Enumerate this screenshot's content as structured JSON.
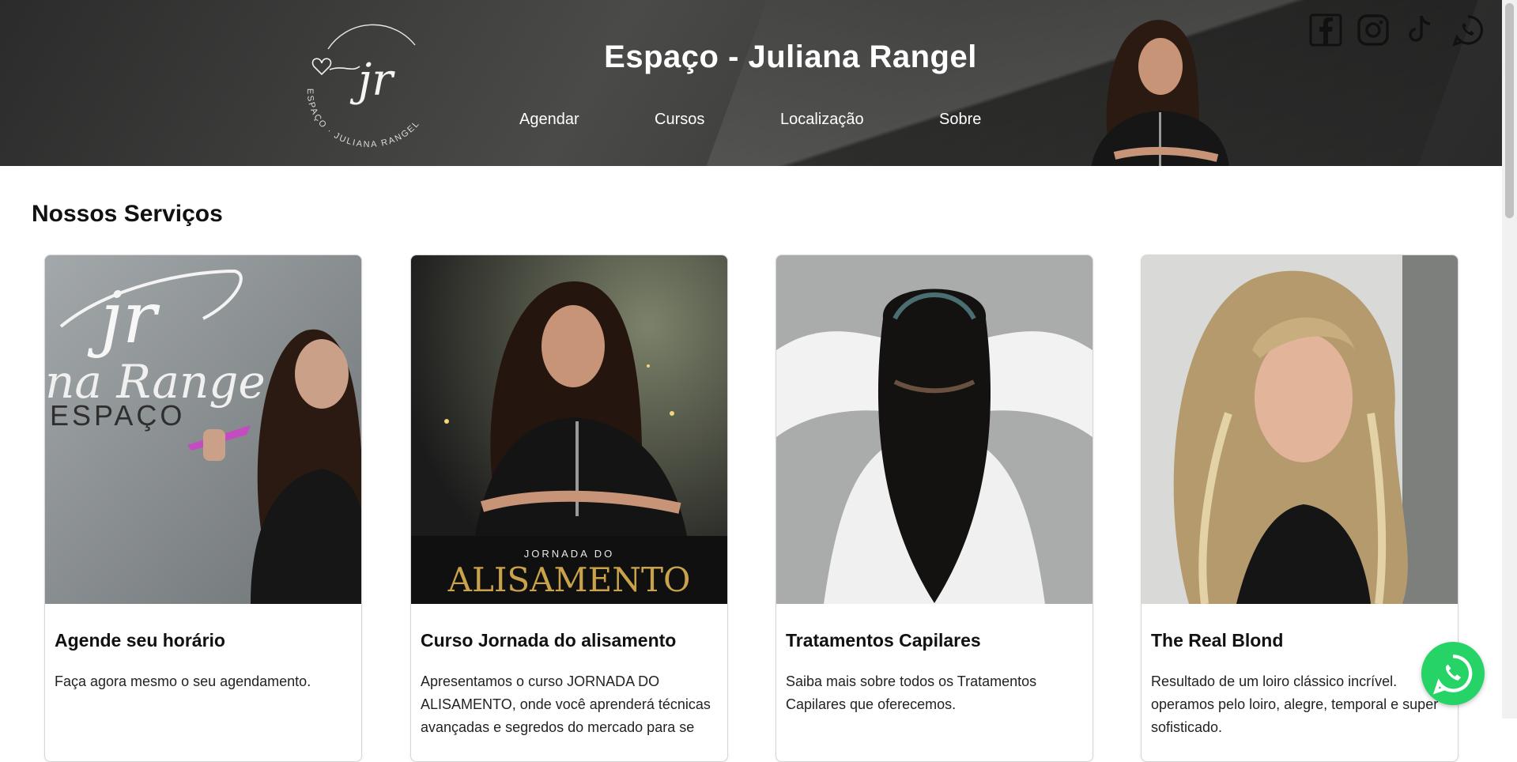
{
  "header": {
    "title": "Espaço - Juliana Rangel",
    "logo_text": "jr",
    "logo_ring_text": "ESPAÇO · JULIANA RANGEL",
    "nav": [
      {
        "label": "Agendar"
      },
      {
        "label": "Cursos"
      },
      {
        "label": "Localização"
      },
      {
        "label": "Sobre"
      }
    ],
    "social_icons": [
      "facebook-icon",
      "instagram-icon",
      "tiktok-icon",
      "whatsapp-icon"
    ]
  },
  "services": {
    "title": "Nossos Serviços",
    "cards": [
      {
        "title": "Agende seu horário",
        "text": "Faça agora mesmo o seu agendamento.",
        "image_text": [
          "jr",
          "na Range",
          "ESPAÇO"
        ]
      },
      {
        "title": "Curso Jornada do alisamento",
        "text": "Apresentamos o curso JORNADA DO ALISAMENTO, onde você aprenderá técnicas avançadas e segredos do mercado para se",
        "image_text": [
          "JORNADA DO",
          "ALISAMENTO"
        ]
      },
      {
        "title": "Tratamentos Capilares",
        "text": "Saiba mais sobre todos os Tratamentos Capilares que oferecemos."
      },
      {
        "title": "The Real Blond",
        "text": "Resultado de um loiro clássico incrível. operamos pelo loiro, alegre, temporal e super sofisticado."
      }
    ]
  },
  "colors": {
    "header_bg": "#3a3a38",
    "whatsapp_green": "#25d366",
    "gold": "#c9a24a"
  }
}
